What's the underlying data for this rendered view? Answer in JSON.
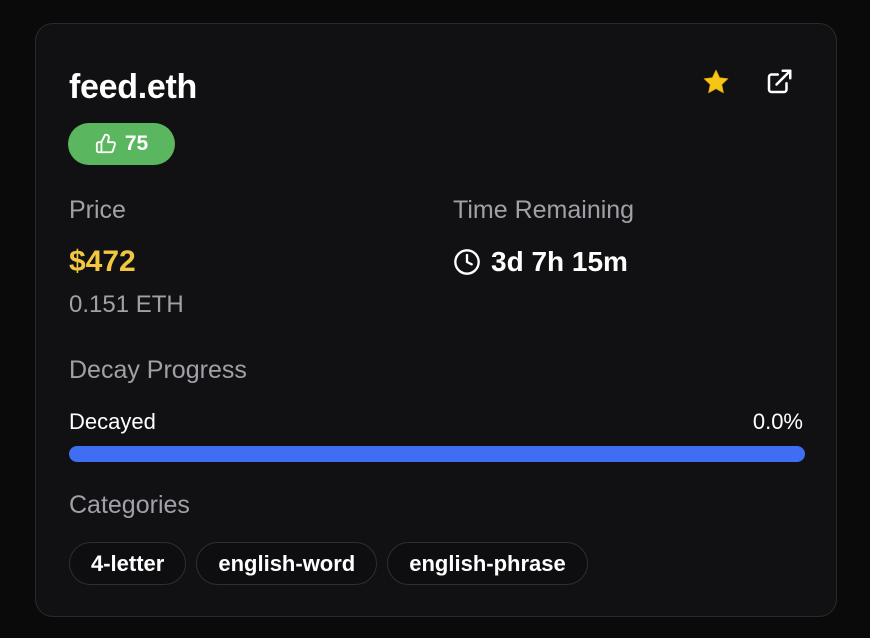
{
  "card": {
    "title": "feed.eth",
    "likes": "75",
    "price_label": "Price",
    "price_usd": "$472",
    "price_eth": "0.151 ETH",
    "time_label": "Time Remaining",
    "time_value": "3d 7h 15m",
    "decay_label": "Decay Progress",
    "decayed_label": "Decayed",
    "decay_percent": "0.0%",
    "decay_fraction": 0.0,
    "categories_label": "Categories",
    "categories": [
      "4-letter",
      "english-word",
      "english-phrase"
    ]
  },
  "icons": {
    "favorite": "star-icon",
    "external": "external-link-icon",
    "likes": "thumbs-up-icon",
    "time": "clock-icon"
  },
  "colors": {
    "accent_price": "#f1c741",
    "likes_badge": "#5bb75f",
    "progress": "#3f6ef3",
    "star": "#f5c518"
  }
}
